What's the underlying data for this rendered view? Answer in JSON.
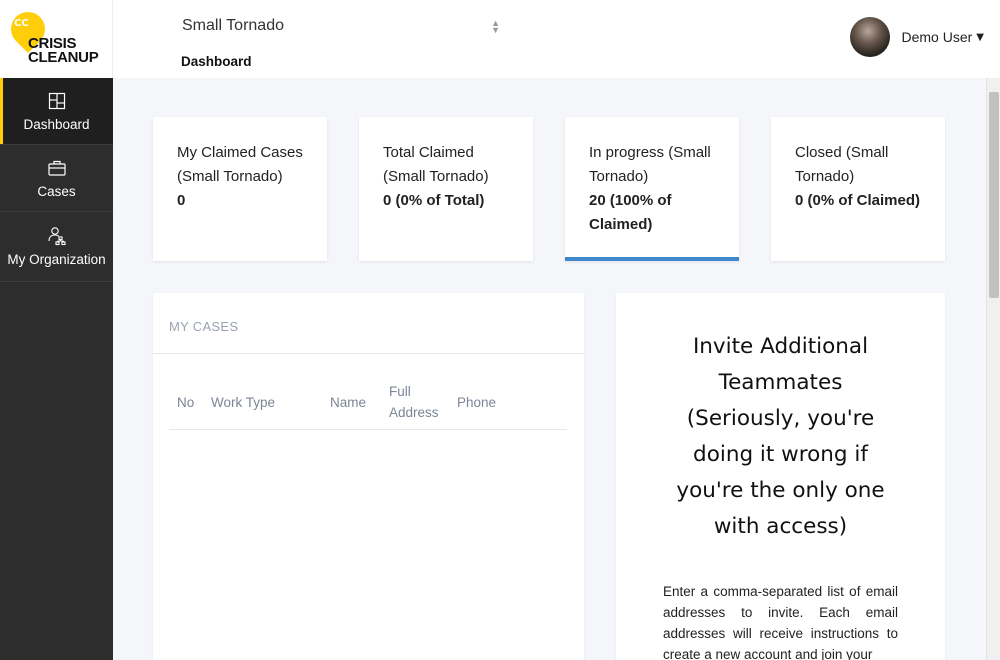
{
  "brand": {
    "badge": "CC",
    "wordmark_line1": "CRISIS",
    "wordmark_line2": "CLEANUP",
    "accent_color": "#fece09"
  },
  "sidebar": {
    "items": [
      {
        "label": "Dashboard",
        "icon": "dashboard-icon",
        "active": true
      },
      {
        "label": "Cases",
        "icon": "briefcase-icon",
        "active": false
      },
      {
        "label": "My Organization",
        "icon": "organization-icon",
        "active": false
      }
    ]
  },
  "header": {
    "incident": "Small Tornado",
    "page_title": "Dashboard",
    "user_name": "Demo User"
  },
  "stats": [
    {
      "title": "My Claimed Cases (Small Tornado)",
      "value": "0"
    },
    {
      "title": "Total Claimed (Small Tornado)",
      "value": "0 (0% of Total)"
    },
    {
      "title": "In progress (Small Tornado)",
      "value": "20 (100% of Claimed)",
      "active": true
    },
    {
      "title": "Closed (Small Tornado)",
      "value": "0 (0% of Claimed)"
    }
  ],
  "my_cases": {
    "heading": "MY CASES",
    "columns": [
      "No",
      "Work Type",
      "Name",
      "Full Address",
      "Phone"
    ]
  },
  "invite": {
    "title": "Invite Additional Teammates (Seriously, you're doing it wrong if you're the only one with access)",
    "text": "Enter a comma-separated list of email addresses to invite. Each email addresses will receive instructions to create a new account and join your"
  },
  "colors": {
    "sidebar_bg": "#2d2d2d",
    "active_tab_underline": "#3f88cb",
    "page_bg": "#f4f6fa"
  }
}
